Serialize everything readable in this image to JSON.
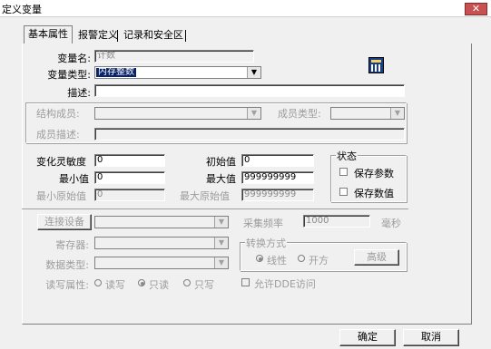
{
  "window": {
    "title": "定义变量",
    "close_glyph": "✕"
  },
  "tabs": [
    {
      "label": "基本属性"
    },
    {
      "label": "报警定义"
    },
    {
      "label": "记录和安全区"
    }
  ],
  "basic": {
    "name_label": "变量名:",
    "name_value": "计数",
    "type_label": "变量类型:",
    "type_value": "内存整数",
    "desc_label": "描述:",
    "desc_value": "",
    "struct_member_label": "结构成员:",
    "struct_member_value": "",
    "member_type_label": "成员类型:",
    "member_type_value": "",
    "member_desc_label": "成员描述:",
    "member_desc_value": ""
  },
  "values": {
    "sensitivity_label": "变化灵敏度",
    "sensitivity_value": "0",
    "initial_label": "初始值",
    "initial_value": "0",
    "min_label": "最小值",
    "min_value": "0",
    "max_label": "最大值",
    "max_value": "999999999",
    "min_raw_label": "最小原始值",
    "min_raw_value": "0",
    "max_raw_label": "最大原始值",
    "max_raw_value": "999999999"
  },
  "status": {
    "group_label": "状态",
    "save_param_label": "保存参数",
    "save_value_label": "保存数值"
  },
  "io": {
    "connect_button": "连接设备",
    "device_value": "",
    "register_label": "寄存器:",
    "register_value": "",
    "data_type_label": "数据类型:",
    "data_type_value": "",
    "rw_label": "读写属性:",
    "rw_options": [
      "读写",
      "只读",
      "只写"
    ],
    "rw_selected": "只读",
    "sample_label": "采集频率",
    "sample_value": "1000",
    "sample_unit": "毫秒",
    "convert_group_label": "转换方式",
    "convert_options": [
      "线性",
      "开方"
    ],
    "convert_selected": "线性",
    "advanced_button": "高级",
    "allow_dde_label": "允许DDE访问"
  },
  "footer": {
    "ok_button": "确定",
    "cancel_button": "取消"
  },
  "icons": {
    "type_dropdown_arrow": "▼",
    "calc_icon": "calculator-icon"
  }
}
